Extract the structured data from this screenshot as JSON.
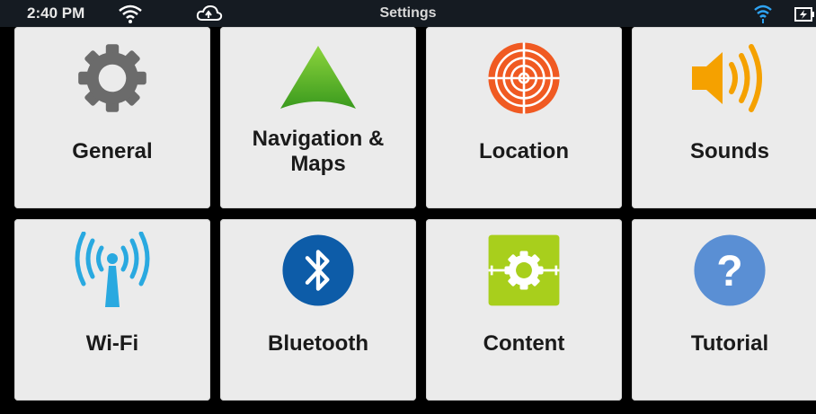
{
  "status_bar": {
    "time": "2:40 PM",
    "title": "Settings",
    "icons": [
      "wifi-icon",
      "cloud-sync-icon",
      "wifi-signal-icon",
      "battery-charging-icon"
    ]
  },
  "tiles": [
    {
      "label": "General",
      "icon": "gear-icon",
      "color": "#6b6b6b"
    },
    {
      "label": "Navigation & Maps",
      "icon": "navigation-arrow-icon",
      "color": "#59b82e"
    },
    {
      "label": "Location",
      "icon": "location-target-icon",
      "color": "#f05a22"
    },
    {
      "label": "Sounds",
      "icon": "speaker-icon",
      "color": "#f5a100"
    },
    {
      "label": "Wi-Fi",
      "icon": "wifi-tower-icon",
      "color": "#29a9e0"
    },
    {
      "label": "Bluetooth",
      "icon": "bluetooth-icon",
      "color": "#0d5ca8"
    },
    {
      "label": "Content",
      "icon": "content-gear-icon",
      "color": "#a8cf1c"
    },
    {
      "label": "Tutorial",
      "icon": "help-icon",
      "color": "#5a8fd4"
    }
  ]
}
